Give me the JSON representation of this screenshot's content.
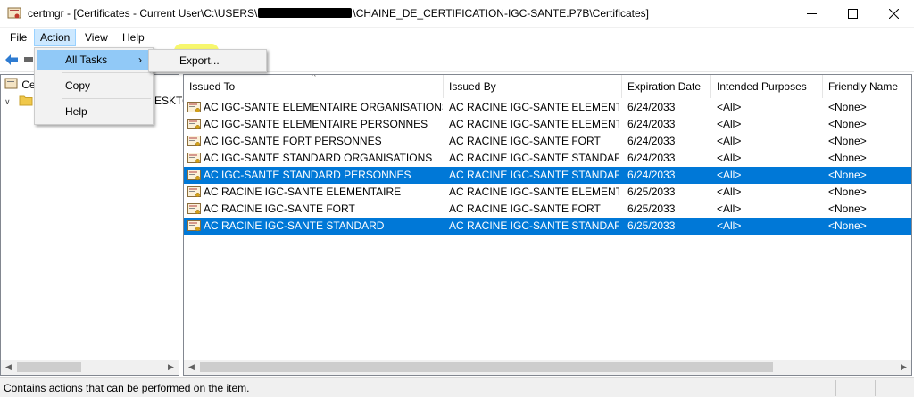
{
  "window": {
    "title_prefix": "certmgr - [Certificates - Current User\\C:\\USERS\\",
    "title_suffix": "\\CHAINE_DE_CERTIFICATION-IGC-SANTE.P7B\\Certificates]"
  },
  "menubar": {
    "items": [
      {
        "label": "File"
      },
      {
        "label": "Action"
      },
      {
        "label": "View"
      },
      {
        "label": "Help"
      }
    ]
  },
  "tree": {
    "root_label": "Ce",
    "child_label": "ESKTO"
  },
  "action_menu": {
    "items": [
      {
        "label": "All Tasks",
        "arrow": "›"
      },
      {
        "label": "Copy"
      },
      {
        "label": "Help"
      }
    ],
    "submenu": {
      "export_label": "Export..."
    }
  },
  "table": {
    "sort_indicator": "^",
    "columns": [
      {
        "label": "Issued To"
      },
      {
        "label": "Issued By"
      },
      {
        "label": "Expiration Date"
      },
      {
        "label": "Intended Purposes"
      },
      {
        "label": "Friendly Name"
      }
    ],
    "rows": [
      {
        "issued_to": "AC IGC-SANTE ELEMENTAIRE ORGANISATIONS",
        "issued_by": "AC RACINE IGC-SANTE ELEMENT...",
        "expiration": "6/24/2033",
        "purposes": "<All>",
        "friendly": "<None>",
        "selected": false
      },
      {
        "issued_to": "AC IGC-SANTE ELEMENTAIRE PERSONNES",
        "issued_by": "AC RACINE IGC-SANTE ELEMENT...",
        "expiration": "6/24/2033",
        "purposes": "<All>",
        "friendly": "<None>",
        "selected": false
      },
      {
        "issued_to": "AC IGC-SANTE FORT PERSONNES",
        "issued_by": "AC RACINE IGC-SANTE FORT",
        "expiration": "6/24/2033",
        "purposes": "<All>",
        "friendly": "<None>",
        "selected": false
      },
      {
        "issued_to": "AC IGC-SANTE STANDARD ORGANISATIONS",
        "issued_by": "AC RACINE IGC-SANTE STANDARD",
        "expiration": "6/24/2033",
        "purposes": "<All>",
        "friendly": "<None>",
        "selected": false
      },
      {
        "issued_to": "AC IGC-SANTE STANDARD PERSONNES",
        "issued_by": "AC RACINE IGC-SANTE STANDARD",
        "expiration": "6/24/2033",
        "purposes": "<All>",
        "friendly": "<None>",
        "selected": true
      },
      {
        "issued_to": "AC RACINE IGC-SANTE ELEMENTAIRE",
        "issued_by": "AC RACINE IGC-SANTE ELEMENT...",
        "expiration": "6/25/2033",
        "purposes": "<All>",
        "friendly": "<None>",
        "selected": false
      },
      {
        "issued_to": "AC RACINE IGC-SANTE FORT",
        "issued_by": "AC RACINE IGC-SANTE FORT",
        "expiration": "6/25/2033",
        "purposes": "<All>",
        "friendly": "<None>",
        "selected": false
      },
      {
        "issued_to": "AC RACINE IGC-SANTE STANDARD",
        "issued_by": "AC RACINE IGC-SANTE STANDARD",
        "expiration": "6/25/2033",
        "purposes": "<All>",
        "friendly": "<None>",
        "selected": true
      }
    ]
  },
  "statusbar": {
    "text": "Contains actions that can be performed on the item."
  },
  "colors": {
    "selection": "#0078d7",
    "menu_hover": "#91c9f7",
    "export_highlight": "#f6f655"
  }
}
